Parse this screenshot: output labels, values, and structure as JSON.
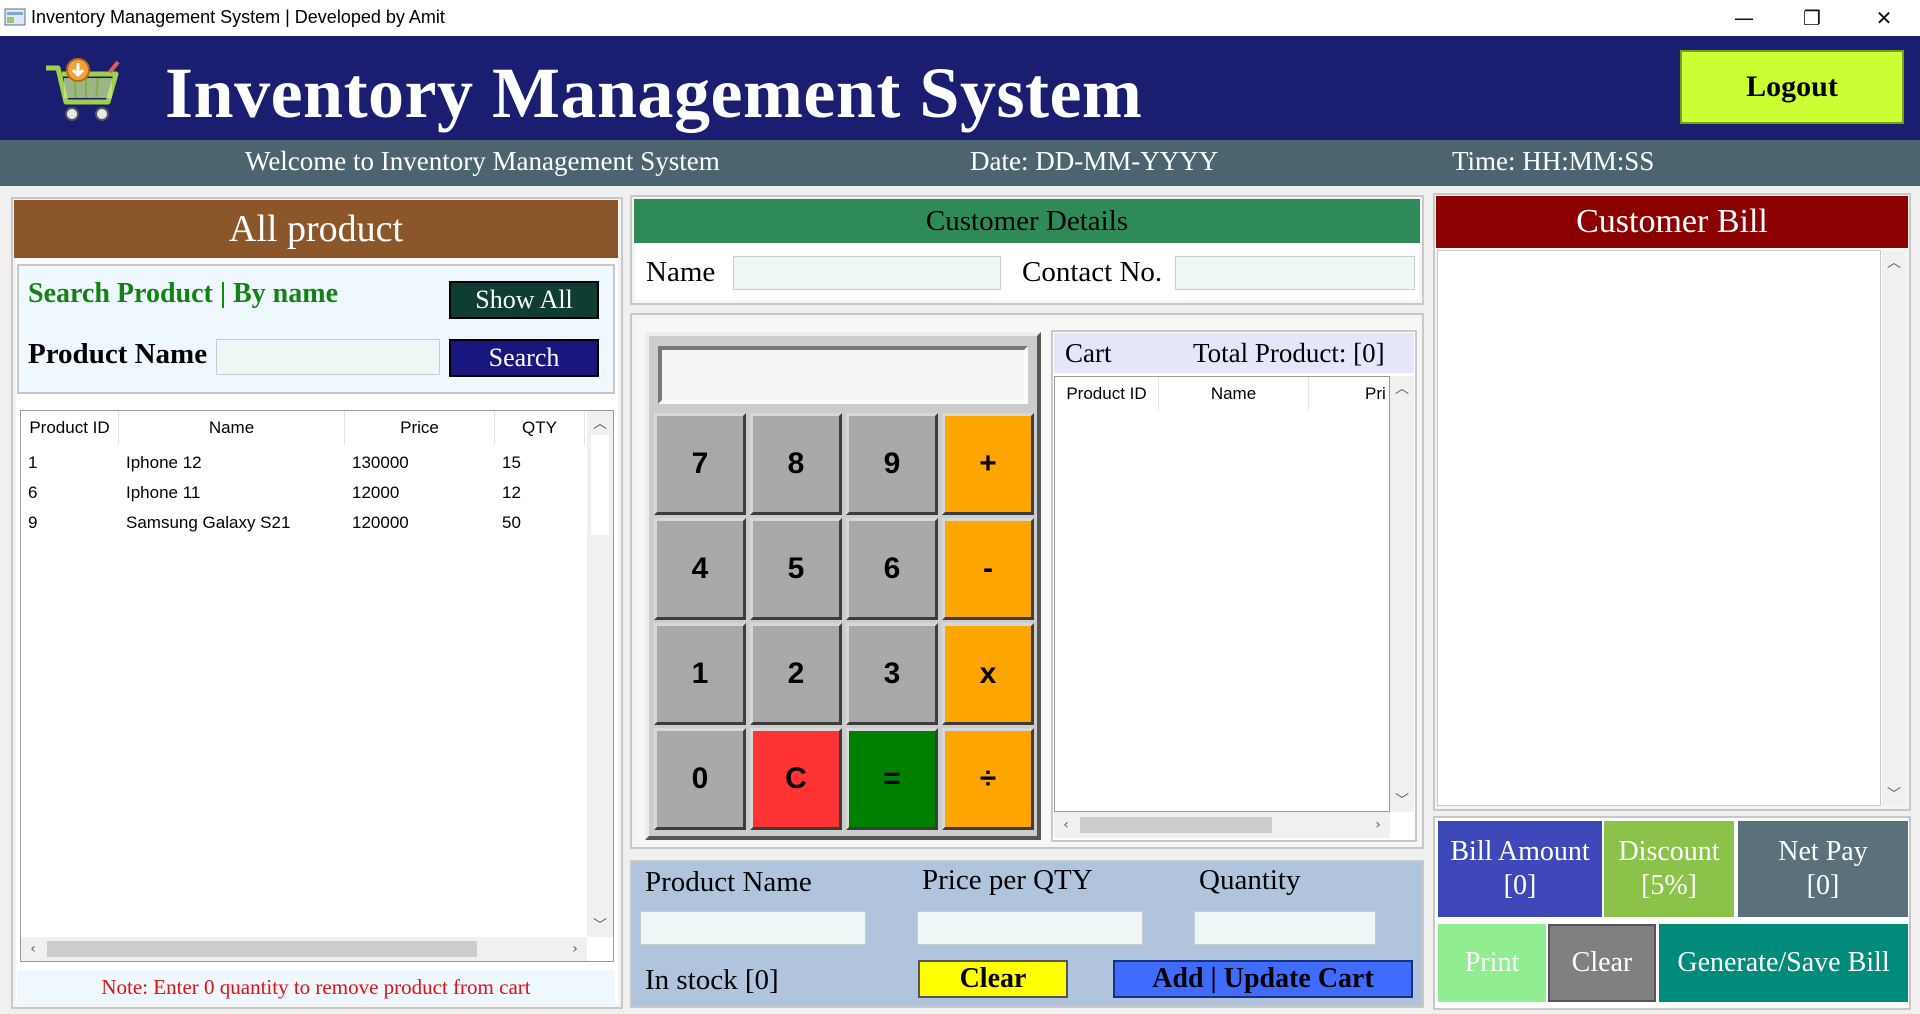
{
  "window": {
    "title": "Inventory Management System | Developed by Amit",
    "minimize_glyph": "—",
    "restore_glyph": "❐",
    "close_glyph": "✕"
  },
  "header": {
    "title": "Inventory Management System",
    "logout_label": "Logout",
    "logo_icon": "shopping-cart-icon"
  },
  "status": {
    "welcome": "Welcome to Inventory Management System",
    "date": "Date: DD-MM-YYYY",
    "time": "Time: HH:MM:SS"
  },
  "products": {
    "heading": "All product",
    "search_title": "Search Product | By name",
    "show_all_label": "Show All",
    "product_name_label": "Product Name",
    "search_input_value": "",
    "search_label": "Search",
    "columns": [
      "Product ID",
      "Name",
      "Price",
      "QTY"
    ],
    "rows": [
      {
        "id": "1",
        "name": "Iphone 12",
        "price": "130000",
        "qty": "15"
      },
      {
        "id": "6",
        "name": "Iphone 11",
        "price": "12000",
        "qty": "12"
      },
      {
        "id": "9",
        "name": "Samsung Galaxy S21",
        "price": "120000",
        "qty": "50"
      }
    ],
    "note": "Note: Enter 0 quantity to remove product from cart"
  },
  "customer": {
    "heading": "Customer Details",
    "name_label": "Name",
    "name_value": "",
    "contact_label": "Contact No.",
    "contact_value": ""
  },
  "calculator": {
    "display_value": "",
    "keys": [
      [
        "7",
        "8",
        "9",
        "+"
      ],
      [
        "4",
        "5",
        "6",
        "-"
      ],
      [
        "1",
        "2",
        "3",
        "x"
      ],
      [
        "0",
        "C",
        "=",
        "÷"
      ]
    ]
  },
  "cart": {
    "title": "Cart",
    "total": "Total Product: [0]",
    "columns": [
      "Product ID",
      "Name",
      "Pri"
    ]
  },
  "add_panel": {
    "product_name_label": "Product Name",
    "price_label": "Price per QTY",
    "quantity_label": "Quantity",
    "product_name_value": "",
    "price_value": "",
    "quantity_value": "",
    "in_stock": "In stock [0]",
    "clear_label": "Clear",
    "add_label": "Add | Update Cart"
  },
  "bill": {
    "heading": "Customer Bill",
    "bill_amount_label": "Bill Amount",
    "bill_amount_value": "[0]",
    "discount_label": "Discount",
    "discount_value": "[5%]",
    "net_pay_label": "Net Pay",
    "net_pay_value": "[0]",
    "print_label": "Print",
    "clear_label": "Clear",
    "generate_label": "Generate/Save Bill"
  },
  "colors": {
    "header_bg": "#1b1e70",
    "status_bg": "#4c6470",
    "logout_bg": "#ccff33",
    "product_heading_bg": "#8b572a",
    "customer_heading_bg": "#2e8b57",
    "bill_heading_bg": "#8b0000",
    "search_button_bg": "#1a1680",
    "show_all_bg": "#0f3d32",
    "cart_add_bg": "#3f6cff",
    "clear_yellow": "#ffff00"
  }
}
